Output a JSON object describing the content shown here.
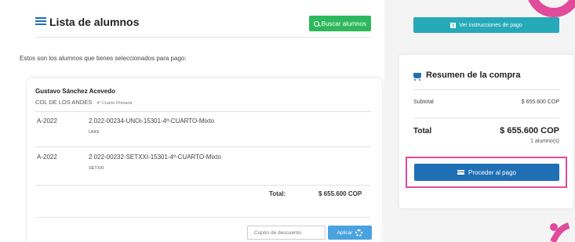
{
  "list": {
    "title": "Lista de alumnos",
    "search_button": "Buscar alumnos",
    "intro": "Estos son los alumnos que tienes seleccionados para pago:"
  },
  "student": {
    "name": "Gustavo Sánchez Acevedo",
    "school": "COL DE LOS ANDES",
    "grade": "4º Cuarto Primaria",
    "items": [
      {
        "year": "A-2022",
        "code": "2.022-00234-UNOi-15301-4º-CUARTO-Mixto",
        "program": "UNOi"
      },
      {
        "year": "A-2022",
        "code": "2.022-00232-SETXXI-15301-4º-CUARTO-Mixto",
        "program": "SETXXI"
      }
    ],
    "total_label": "Total:",
    "total_value": "$ 655.600 COP",
    "coupon_placeholder": "Cupón de descuento",
    "apply_button": "Aplicar"
  },
  "instructions_button": "Ver instrucciones de pago",
  "summary": {
    "title": "Resumen de la compra",
    "subtotal_label": "Subtotal",
    "subtotal_value": "$ 655.600 COP",
    "total_label": "Total",
    "total_value": "$ 655.600 COP",
    "students_count": "1 alumno(s)",
    "pay_button": "Proceder al pago"
  },
  "colors": {
    "accent_green": "#2eb85c",
    "accent_teal": "#26a9b8",
    "primary_blue": "#1f6fb5",
    "highlight_pink": "#e14a9b"
  },
  "icons": [
    "list-icon",
    "search-icon",
    "info-icon",
    "cart-icon",
    "credit-card-icon",
    "gear-icon"
  ]
}
